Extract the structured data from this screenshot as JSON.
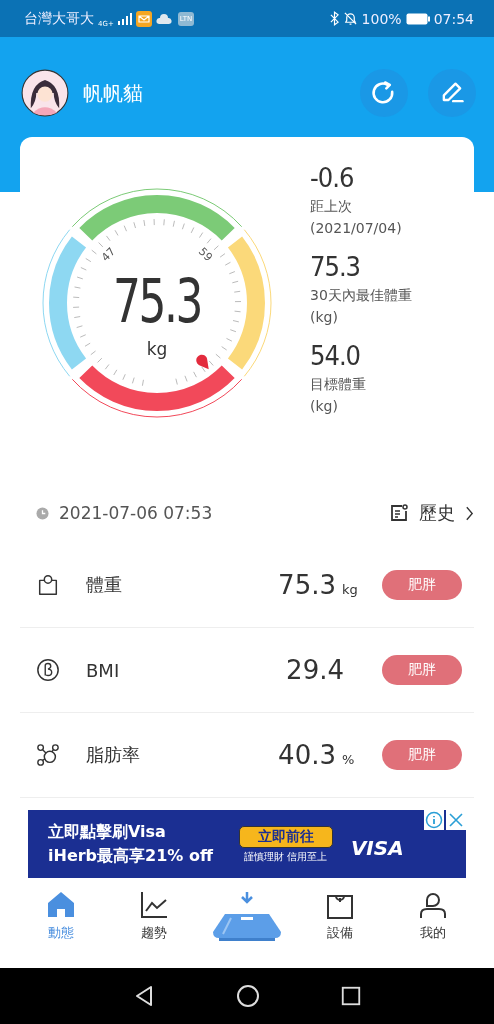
{
  "status_bar": {
    "carrier": "台灣大哥大",
    "network": "4G+",
    "app_badge": "LTN",
    "battery": "100%",
    "time": "07:54"
  },
  "header": {
    "user_name": "帆帆貓"
  },
  "gauge": {
    "value": "75.3",
    "unit": "kg",
    "tick_labels": [
      "47",
      "59"
    ]
  },
  "summary": [
    {
      "value": "-0.6",
      "label": "距上次",
      "note": "(2021/07/04)"
    },
    {
      "value": "75.3",
      "label": "30天內最佳體重",
      "note": "(kg)"
    },
    {
      "value": "54.0",
      "label": "目標體重",
      "note": "(kg)"
    }
  ],
  "measured_at": "2021-07-06 07:53",
  "history_link": "歷史",
  "metrics": [
    {
      "kind": "weight",
      "name": "體重",
      "value": "75.3",
      "unit": "kg",
      "status": "肥胖"
    },
    {
      "kind": "bmi",
      "name": "BMI",
      "value": "29.4",
      "status": "肥胖"
    },
    {
      "kind": "fat",
      "name": "脂肪率",
      "value": "40.3",
      "unit": "%",
      "status": "肥胖"
    }
  ],
  "ad": {
    "headline": "立即點擊刷Visa",
    "subline": "iHerb最高享21% off",
    "cta": "立即前往",
    "fine_print": "謹慎理財 信用至上",
    "brand": "VISA"
  },
  "tabs": [
    {
      "kind": "home",
      "label": "動態",
      "selected": true
    },
    {
      "kind": "trend",
      "label": "趨勢",
      "selected": false
    },
    {
      "kind": "scale",
      "selected": false
    },
    {
      "kind": "device",
      "label": "設備",
      "selected": false
    },
    {
      "kind": "profile",
      "label": "我的",
      "selected": false
    }
  ]
}
